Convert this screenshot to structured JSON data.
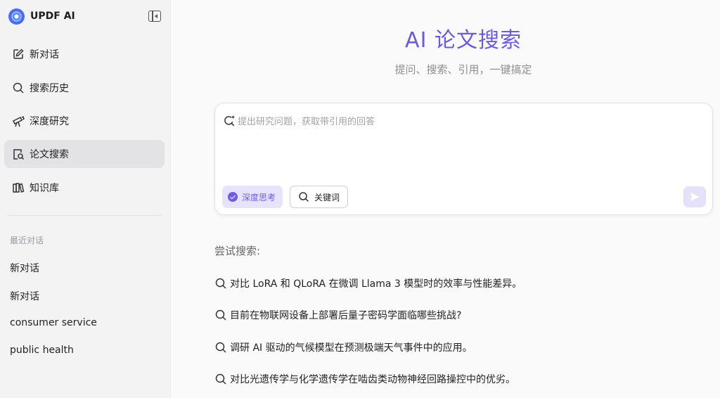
{
  "brand": {
    "name": "UPDF AI",
    "logo_icon": "updf-logo-icon"
  },
  "sidebar": {
    "nav": [
      {
        "label": "新对话",
        "icon": "new-chat-icon",
        "active": false
      },
      {
        "label": "搜索历史",
        "icon": "search-icon",
        "active": false
      },
      {
        "label": "深度研究",
        "icon": "telescope-icon",
        "active": false
      },
      {
        "label": "论文搜索",
        "icon": "paper-search-icon",
        "active": true
      },
      {
        "label": "知识库",
        "icon": "books-icon",
        "active": false
      }
    ],
    "recent_title": "最近对话",
    "recent": [
      "新对话",
      "新对话",
      "consumer service",
      "public health"
    ]
  },
  "main": {
    "title": "AI 论文搜索",
    "subtitle": "提问、搜索、引用，一键搞定",
    "search": {
      "placeholder": "提出研究问题，获取带引用的回答",
      "value": "",
      "deep_think_label": "深度思考",
      "deep_think_checked": true,
      "keyword_label": "关键词"
    },
    "try_title": "尝试搜索:",
    "suggestions": [
      "对比 LoRA 和 QLoRA 在微调 Llama 3 模型时的效率与性能差异。",
      "目前在物联网设备上部署后量子密码学面临哪些挑战?",
      "调研 AI 驱动的气候模型在预测极端天气事件中的应用。",
      "对比光遗传学与化学遗传学在啮齿类动物神经回路操控中的优劣。"
    ]
  },
  "colors": {
    "accent": "#6a5ae0",
    "chip_bg": "#e6e3fa",
    "active_nav_bg": "#e3e3e6",
    "sidebar_bg": "#f3f3f4"
  }
}
